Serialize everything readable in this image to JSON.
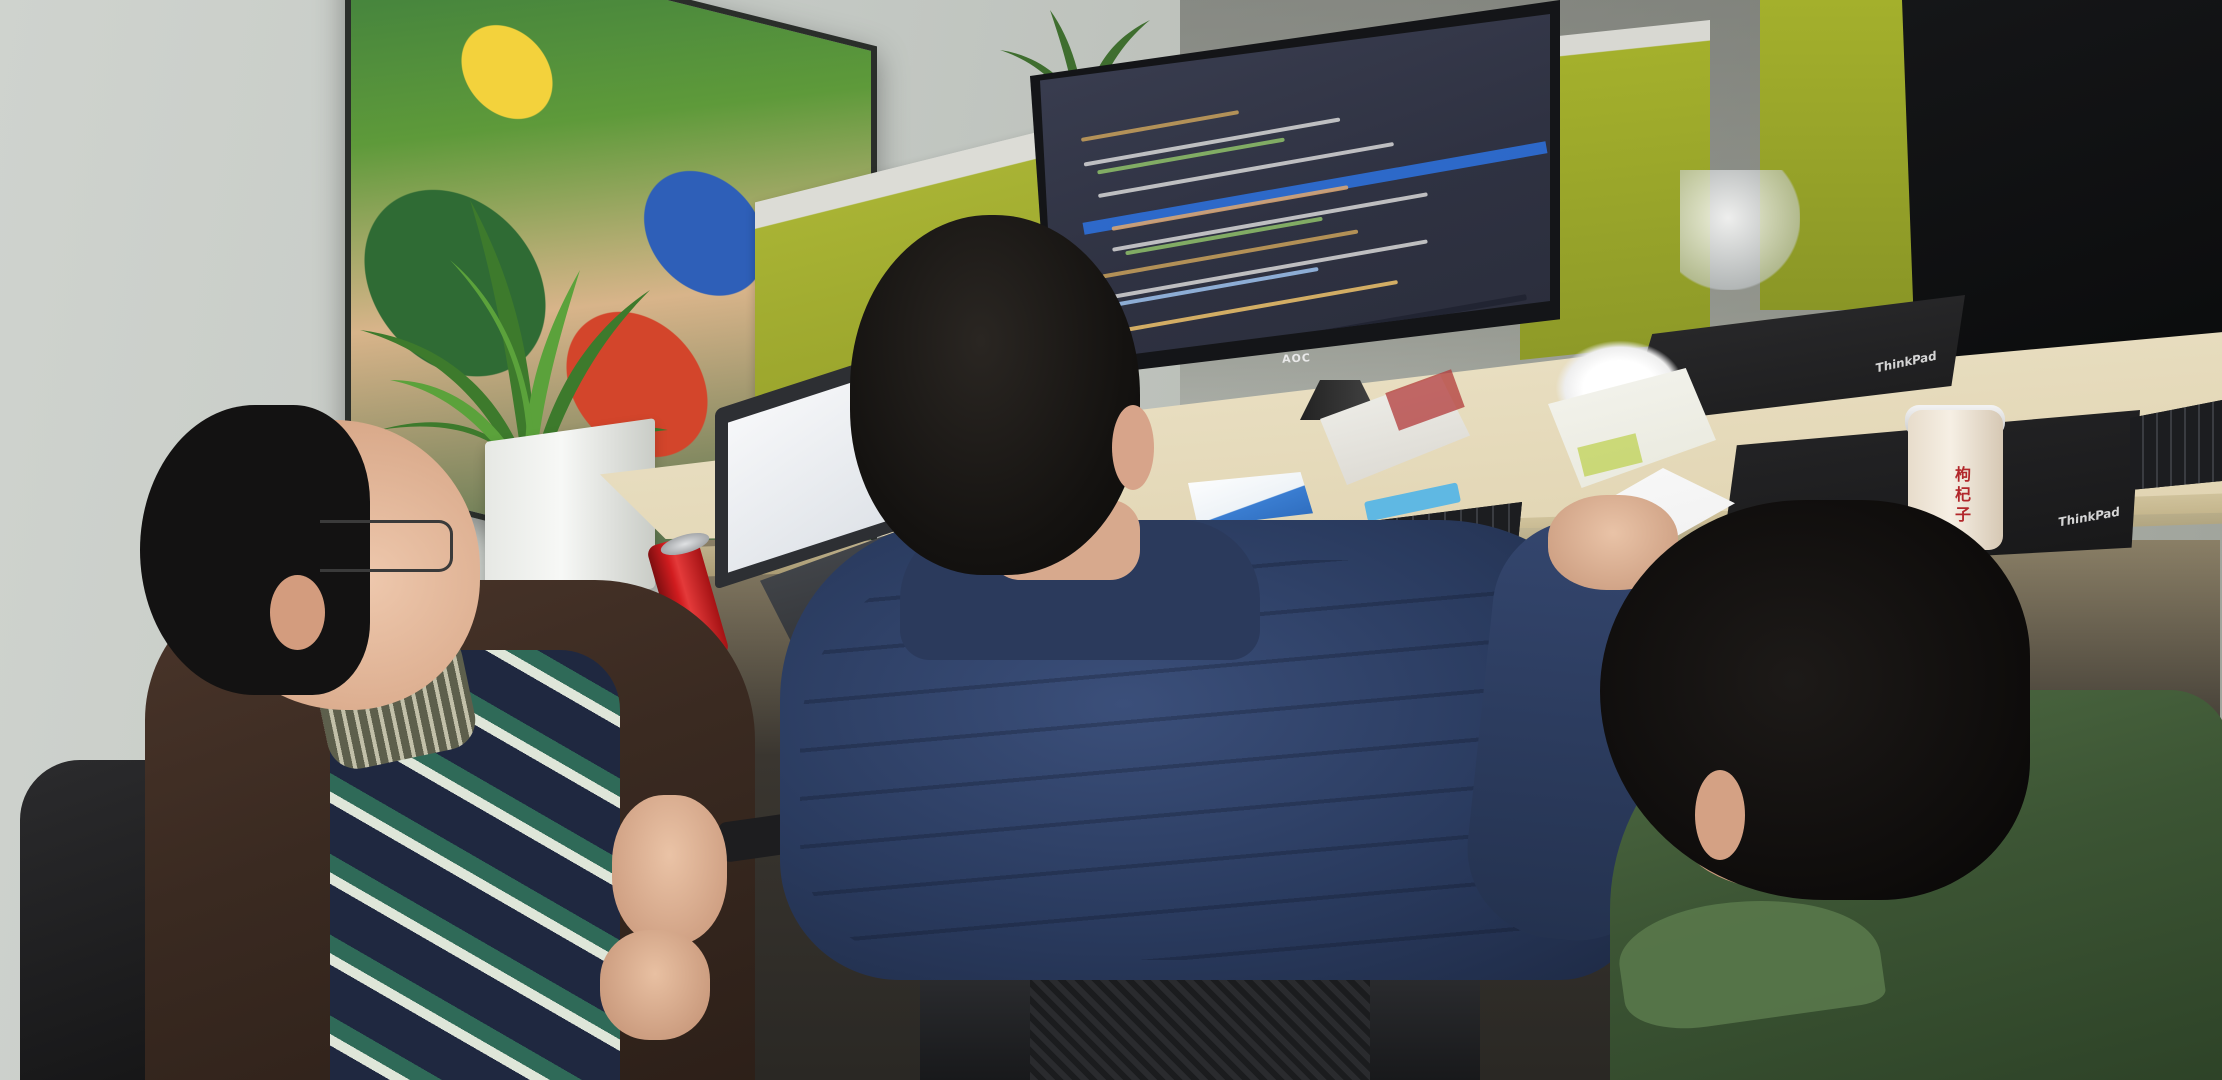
{
  "scene": {
    "type": "photo",
    "description_colors": {
      "wall": "#c3c8c3",
      "partition_green": "#a4b02c",
      "desk": "#e3d7b6",
      "jacket_navy": "#2a3b5f",
      "jacket_green": "#3c5534",
      "can_red": "#d11c1f"
    }
  },
  "monitor": {
    "brand": "AOC"
  },
  "laptops": {
    "brand_1": "ThinkPad",
    "brand_2": "ThinkPad"
  },
  "jar": {
    "label": "枸杞子"
  }
}
